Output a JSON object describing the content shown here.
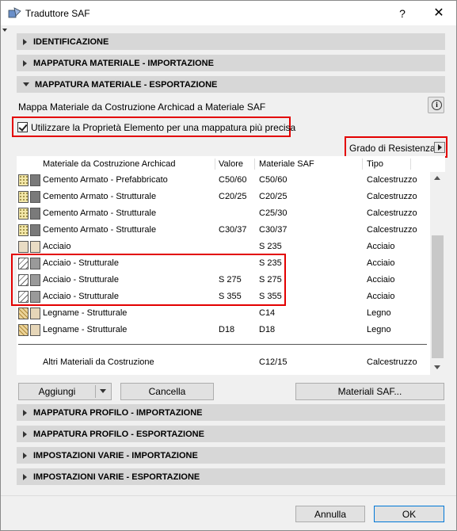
{
  "window": {
    "title": "Traduttore SAF",
    "help": "?",
    "close": "✕"
  },
  "sections_top": [
    {
      "label": "IDENTIFICAZIONE",
      "expanded": false
    },
    {
      "label": "MAPPATURA MATERIALE - IMPORTAZIONE",
      "expanded": false
    },
    {
      "label": "MAPPATURA MATERIALE - ESPORTAZIONE",
      "expanded": true
    }
  ],
  "mapping": {
    "label": "Mappa  Materiale da Costruzione Archicad a Materiale SAF",
    "info_icon": "i",
    "checkbox_label": "Utilizzare la Proprietà Elemento per una mappatura più precisa",
    "checkbox_checked": true,
    "grade_label": "Grado di Resistenza"
  },
  "table": {
    "headers": [
      "Materiale da Costruzione Archicad",
      "Valore",
      "Materiale SAF",
      "Tipo"
    ],
    "rows": [
      {
        "material": "Cemento Armato - Prefabbricato",
        "value": "C50/60",
        "saf": "C50/60",
        "type": "Calcestruzzo",
        "swatch": "concrete"
      },
      {
        "material": "Cemento Armato - Strutturale",
        "value": "C20/25",
        "saf": "C20/25",
        "type": "Calcestruzzo",
        "swatch": "concrete"
      },
      {
        "material": "Cemento Armato - Strutturale",
        "value": "",
        "saf": "C25/30",
        "type": "Calcestruzzo",
        "swatch": "concrete"
      },
      {
        "material": "Cemento Armato - Strutturale",
        "value": "C30/37",
        "saf": "C30/37",
        "type": "Calcestruzzo",
        "swatch": "concrete"
      },
      {
        "material": "Acciaio",
        "value": "",
        "saf": "S 235",
        "type": "Acciaio",
        "swatch": "steel-plain"
      },
      {
        "material": "Acciaio - Strutturale",
        "value": "",
        "saf": "S 235",
        "type": "Acciaio",
        "swatch": "steel"
      },
      {
        "material": "Acciaio - Strutturale",
        "value": "S 275",
        "saf": "S 275",
        "type": "Acciaio",
        "swatch": "steel"
      },
      {
        "material": "Acciaio - Strutturale",
        "value": "S 355",
        "saf": "S 355",
        "type": "Acciaio",
        "swatch": "steel"
      },
      {
        "material": "Legname - Strutturale",
        "value": "",
        "saf": "C14",
        "type": "Legno",
        "swatch": "wood"
      },
      {
        "material": "Legname - Strutturale",
        "value": "D18",
        "saf": "D18",
        "type": "Legno",
        "swatch": "wood"
      }
    ],
    "other": {
      "material": "Altri Materiali da Costruzione",
      "value": "",
      "saf": "C12/15",
      "type": "Calcestruzzo"
    }
  },
  "buttons": {
    "add": "Aggiungi",
    "delete": "Cancella",
    "saf_materials": "Materiali SAF..."
  },
  "sections_bottom": [
    {
      "label": "MAPPATURA PROFILO - IMPORTAZIONE",
      "expanded": false
    },
    {
      "label": "MAPPATURA PROFILO - ESPORTAZIONE",
      "expanded": false
    },
    {
      "label": "IMPOSTAZIONI VARIE - IMPORTAZIONE",
      "expanded": false
    },
    {
      "label": "IMPOSTAZIONI VARIE - ESPORTAZIONE",
      "expanded": false
    }
  ],
  "footer": {
    "cancel": "Annulla",
    "ok": "OK"
  },
  "colors": {
    "highlight": "#e30000",
    "section_bg": "#d7d7d7",
    "ok_border": "#0078d7"
  }
}
